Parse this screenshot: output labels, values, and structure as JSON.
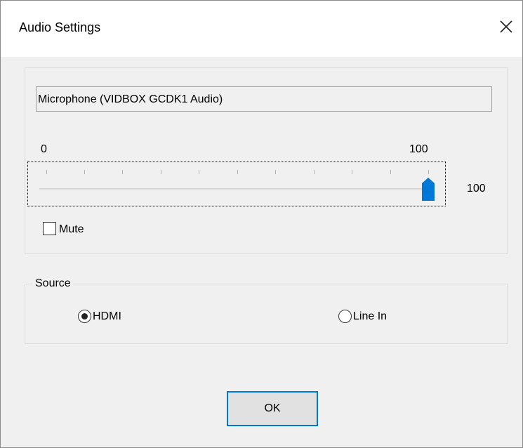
{
  "window": {
    "title": "Audio Settings",
    "close_icon": "close-icon"
  },
  "device": {
    "name": "Microphone (VIDBOX GCDK1 Audio)"
  },
  "volume": {
    "range_min": "0",
    "range_max": "100",
    "value": "100",
    "level": 100
  },
  "mute": {
    "label": "Mute",
    "checked": false
  },
  "source": {
    "legend": "Source",
    "options": [
      {
        "label": "HDMI",
        "selected": true
      },
      {
        "label": "Line In",
        "selected": false
      }
    ]
  },
  "buttons": {
    "ok_label": "OK"
  },
  "colors": {
    "accent": "#0078d7",
    "dialog_bg": "#f0f0f0"
  }
}
